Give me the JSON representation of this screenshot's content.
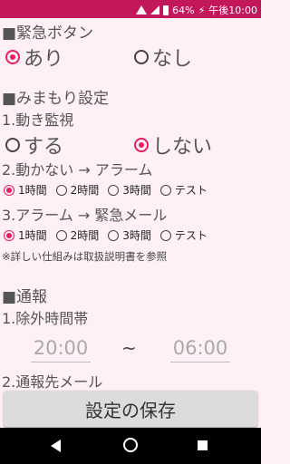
{
  "status_bar": {
    "battery": "64%",
    "time": "午後10:00"
  },
  "sections": {
    "emergency": {
      "title": "■緊急ボタン",
      "options": [
        "あり",
        "なし"
      ],
      "selected": 0
    },
    "monitor": {
      "title": "■みまもり設定",
      "sub1": "1.動き監視",
      "sub1_options": [
        "する",
        "しない"
      ],
      "sub1_selected": 1,
      "sub2": "2.動かない → アラーム",
      "sub2_options": [
        "1時間",
        "2時間",
        "3時間",
        "テスト"
      ],
      "sub2_selected": 0,
      "sub3": "3.アラーム → 緊急メール",
      "sub3_options": [
        "1時間",
        "2時間",
        "3時間",
        "テスト"
      ],
      "sub3_selected": 0,
      "note": "※詳しい仕組みは取扱説明書を参照"
    },
    "report": {
      "title": "■通報",
      "sub1": "1.除外時間帯",
      "time_from": "20:00",
      "time_sep": "~",
      "time_to": "06:00",
      "sub2": "2.通報先メール"
    }
  },
  "save_button": "設定の保存",
  "colors": {
    "status": "#c2185b",
    "accent": "#e91e63",
    "background": "#fff0f6"
  }
}
